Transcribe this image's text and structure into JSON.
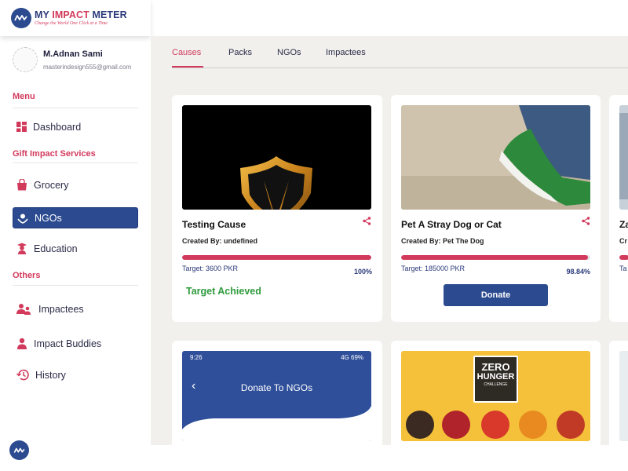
{
  "brand": {
    "title_main": "MY ",
    "title_accent": "IMPACT",
    "title_end": " METER",
    "tagline": "Change the World One Click at a Time"
  },
  "user": {
    "name": "M.Adnan Sami",
    "email": "masterindesign555@gmail.com"
  },
  "sidebar": {
    "menu_label": "Menu",
    "gift_label": "Gift Impact Services",
    "others_label": "Others",
    "items": {
      "dashboard": "Dashboard",
      "grocery": "Grocery",
      "ngos": "NGOs",
      "education": "Education",
      "impactees": "Impactees",
      "impact_buddies": "Impact Buddies",
      "history": "History"
    },
    "active": "ngos"
  },
  "tabs": [
    "Causes",
    "Packs",
    "NGOs",
    "Impactees"
  ],
  "active_tab": "Causes",
  "cards": [
    {
      "title": "Testing Cause",
      "created_by_label": "Created By:",
      "created_by": "undefined",
      "target": "Target: 3600 PKR",
      "percent": "100%",
      "progress": 1.0,
      "status": "Target Achieved"
    },
    {
      "title": "Pet A Stray Dog or Cat",
      "created_by_label": "Created By:",
      "created_by": "Pet The Dog",
      "target": "Target: 185000 PKR",
      "percent": "98.84%",
      "progress": 0.9884,
      "button": "Donate"
    },
    {
      "title": "Za",
      "created_by_label": "Cr",
      "progress": 0.05,
      "target": "Ta"
    }
  ],
  "cards_row2": {
    "phone": {
      "time": "9:26",
      "status_right": "4G 69%",
      "title": "Donate To NGOs"
    },
    "zero_hunger": {
      "line1": "ZERO",
      "line2": "HUNGER",
      "line3": "CHALLENGE"
    }
  },
  "colors": {
    "primary": "#2b4a8f",
    "accent": "#d23a5c",
    "success": "#2e9a3c",
    "background": "#f1f0ed"
  }
}
